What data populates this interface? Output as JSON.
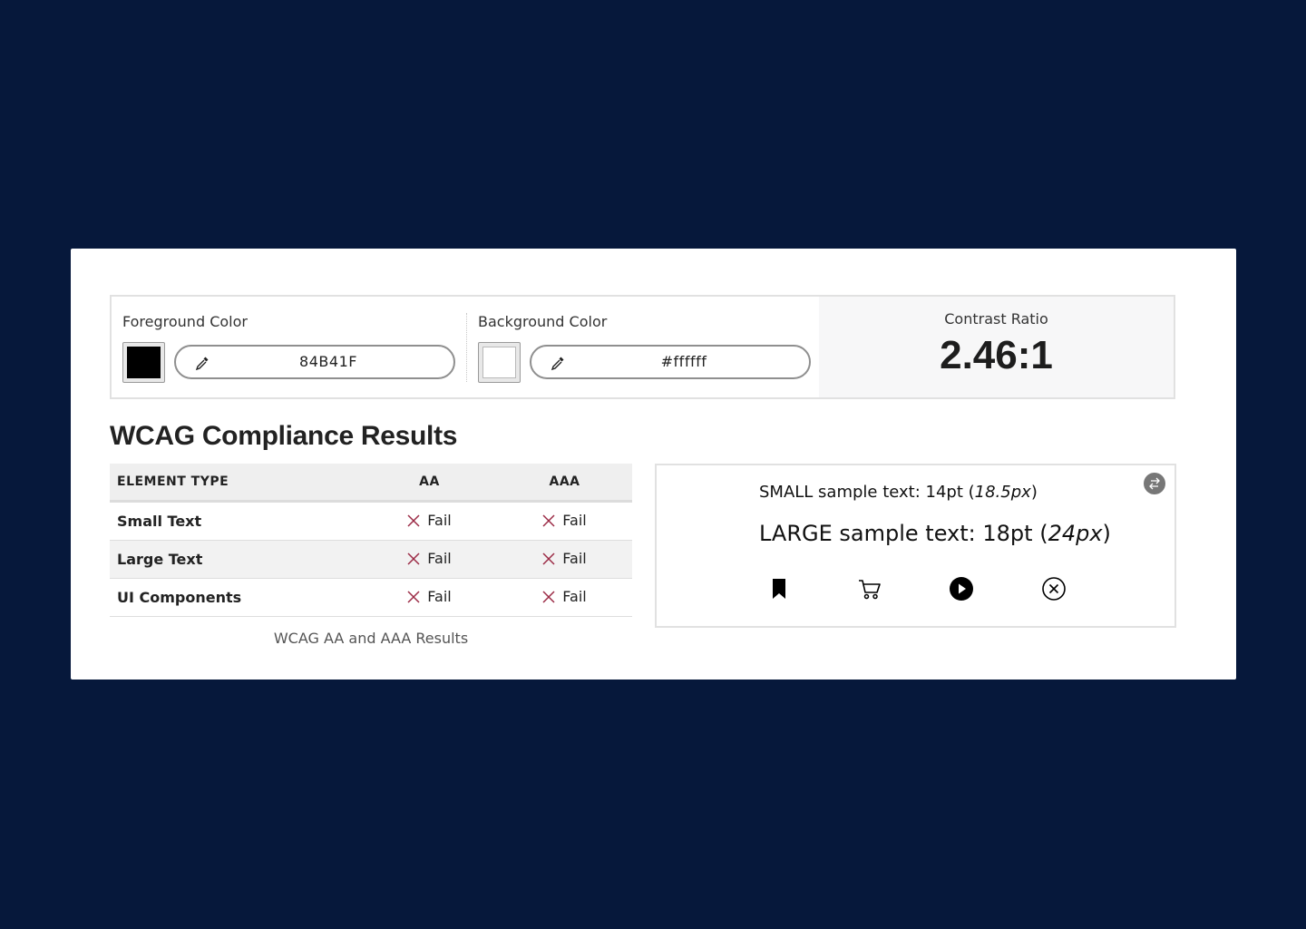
{
  "foreground": {
    "label": "Foreground Color",
    "hex": "84B41F"
  },
  "background": {
    "label": "Background Color",
    "hex": "#ffffff"
  },
  "contrast": {
    "label": "Contrast Ratio",
    "value": "2.46:1"
  },
  "results": {
    "heading": "WCAG Compliance Results",
    "columns": [
      "ELEMENT TYPE",
      "AA",
      "AAA"
    ],
    "rows": [
      {
        "type": "Small Text",
        "aa": "Fail",
        "aaa": "Fail"
      },
      {
        "type": "Large Text",
        "aa": "Fail",
        "aaa": "Fail"
      },
      {
        "type": "UI Components",
        "aa": "Fail",
        "aaa": "Fail"
      }
    ],
    "caption": "WCAG AA and AAA Results"
  },
  "sample": {
    "small_prefix": "SMALL sample text: 14pt (",
    "small_px": "18.5px",
    "small_suffix": ")",
    "large_prefix": "LARGE sample text: 18pt (",
    "large_px": "24px",
    "large_suffix": ")",
    "icons": [
      "bookmark-icon",
      "cart-icon",
      "play-circle-icon",
      "close-circle-icon",
      "swap-icon"
    ]
  },
  "colors": {
    "page_bg": "#06183b",
    "fail_mark": "#9b2a45",
    "swatch_fg": "#000000",
    "swatch_bg": "#ffffff"
  }
}
